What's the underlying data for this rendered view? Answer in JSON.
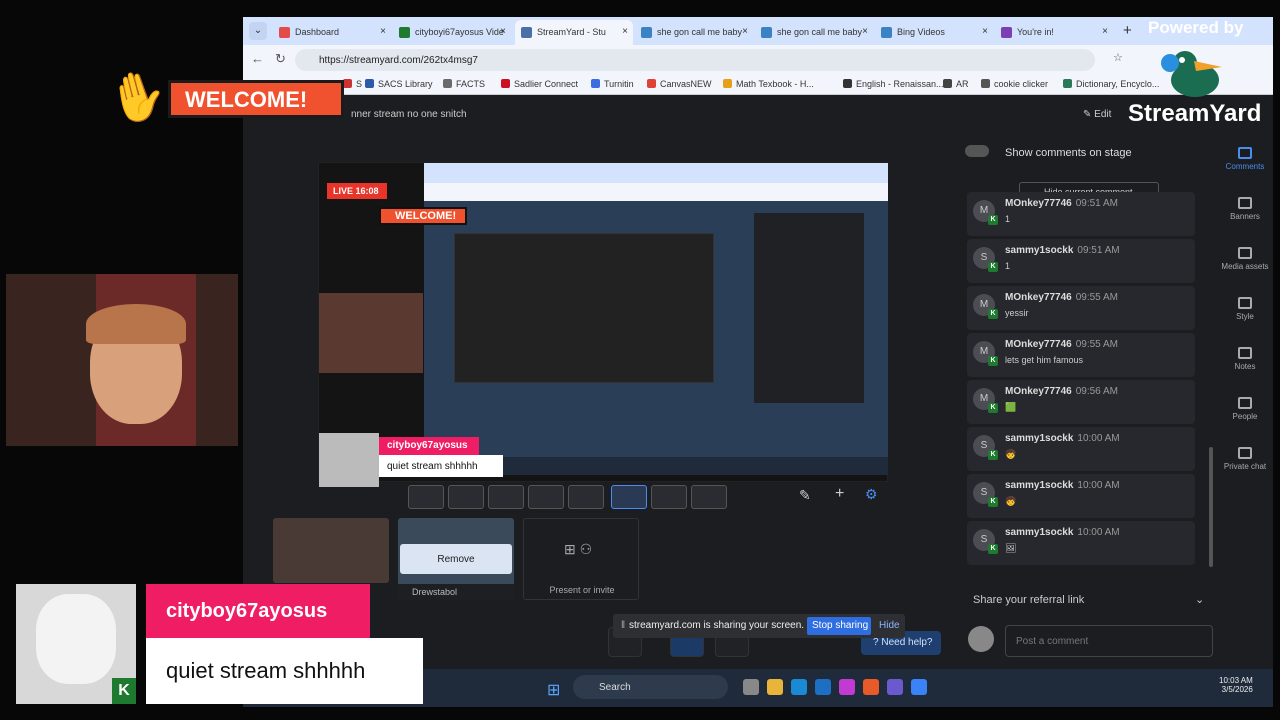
{
  "browser": {
    "tabs": [
      {
        "label": "Dashboard",
        "color": "#e34b4b"
      },
      {
        "label": "cityboyi67ayosus Vide",
        "color": "#1e7a2f"
      },
      {
        "label": "StreamYard - Stu",
        "color": "#4a6fa5",
        "active": true
      },
      {
        "label": "she gon call me baby",
        "color": "#3b82c4"
      },
      {
        "label": "she gon call me baby",
        "color": "#3b82c4"
      },
      {
        "label": "Bing Videos",
        "color": "#3b82c4"
      },
      {
        "label": "You're in!",
        "color": "#7b3fb3"
      }
    ],
    "url": "https://streamyard.com/262tx4msg7",
    "bookmarks": [
      "S",
      "SACS Library",
      "FACTS",
      "Sadlier Connect",
      "Turnitin",
      "CanvasNEW",
      "Math Texbook - H...",
      "English - Renaissan...",
      "AR",
      "cookie clicker",
      "Dictionary, Encyclo..."
    ]
  },
  "app": {
    "stream_title": "nner stream no one snitch",
    "edit_label": "Edit",
    "show_comments_label": "Show comments on stage",
    "hide_current_comment": "Hide current comment",
    "live_badge": "LIVE 16:08",
    "remove_label": "Remove",
    "present_label": "Present or invite",
    "source_label": "Drewstabol",
    "referral": "Share your referral link",
    "post_placeholder": "Post a comment"
  },
  "comments": [
    {
      "name": "MOnkey77746",
      "time": "09:51 AM",
      "text": "1",
      "initial": "M"
    },
    {
      "name": "sammy1sockk",
      "time": "09:51 AM",
      "text": "1",
      "initial": "S"
    },
    {
      "name": "MOnkey77746",
      "time": "09:55 AM",
      "text": "yessir",
      "initial": "M"
    },
    {
      "name": "MOnkey77746",
      "time": "09:55 AM",
      "text": "lets get him famous",
      "initial": "M"
    },
    {
      "name": "MOnkey77746",
      "time": "09:56 AM",
      "text": "🟩",
      "initial": "M"
    },
    {
      "name": "sammy1sockk",
      "time": "10:00 AM",
      "text": "🧒",
      "initial": "S"
    },
    {
      "name": "sammy1sockk",
      "time": "10:00 AM",
      "text": "🧒",
      "initial": "S"
    },
    {
      "name": "sammy1sockk",
      "time": "10:00 AM",
      "text": "🖼",
      "initial": "S"
    }
  ],
  "rail": [
    "Comments",
    "Banners",
    "Media assets",
    "Style",
    "Notes",
    "People",
    "Private chat"
  ],
  "share_bar": {
    "text": "streamyard.com is sharing your screen.",
    "stop": "Stop sharing",
    "hide": "Hide",
    "help": "Need help?"
  },
  "taskbar": {
    "search": "Search",
    "time": "10:03 AM",
    "date": "3/5/2026"
  },
  "overlay": {
    "welcome": "WELCOME!",
    "powered_by": "Powered by",
    "logo": "StreamYard",
    "banner_name": "cityboy67ayosus",
    "banner_text": "quiet stream shhhhh",
    "stage_banner_name": "cityboy67ayosus",
    "stage_banner_text": "quiet stream shhhhh",
    "stage_welcome": "WELCOME!"
  },
  "colors": {
    "accent": "#ef1d64",
    "welcome": "#f0522f",
    "stop": "#2f6ee0",
    "live": "#e8352a"
  }
}
